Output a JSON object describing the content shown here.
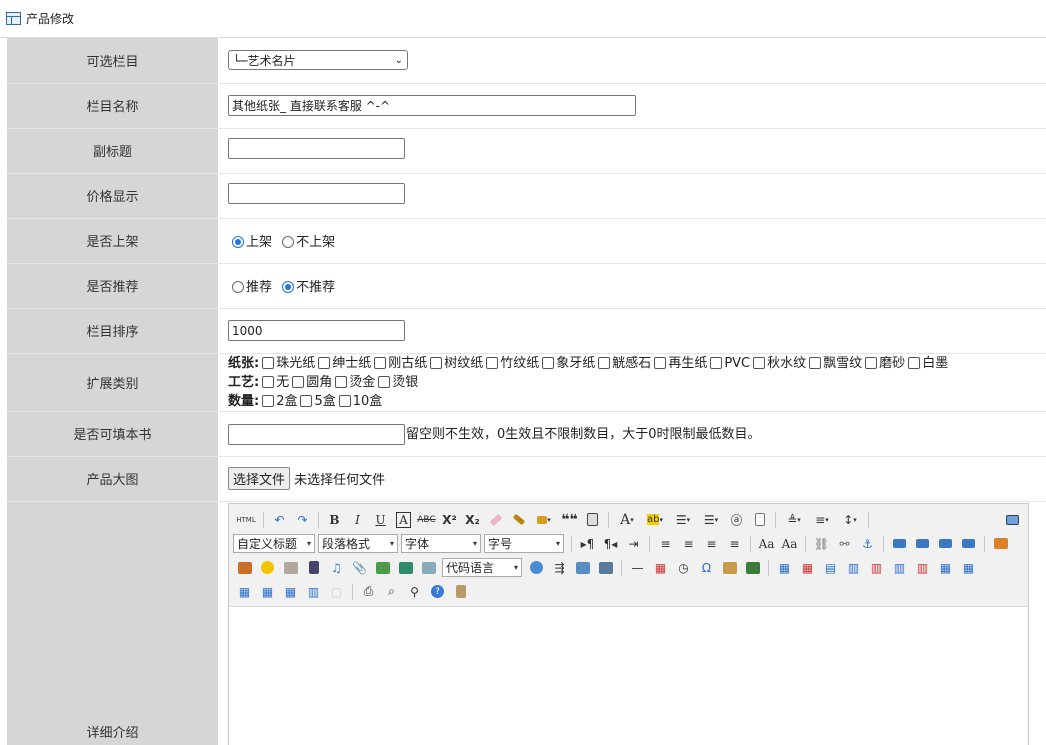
{
  "page_title": "产品修改",
  "fields": {
    "category": {
      "label": "可选栏目",
      "value": "└─艺术名片"
    },
    "name": {
      "label": "栏目名称",
      "value": "其他纸张_ 直接联系客服  ^-^"
    },
    "subtitle": {
      "label": "副标题",
      "value": ""
    },
    "price": {
      "label": "价格显示",
      "value": ""
    },
    "shelf": {
      "label": "是否上架",
      "opt1": "上架",
      "opt2": "不上架",
      "selected": "上架"
    },
    "recommend": {
      "label": "是否推荐",
      "opt1": "推荐",
      "opt2": "不推荐",
      "selected": "不推荐"
    },
    "sort": {
      "label": "栏目排序",
      "value": "1000"
    },
    "ext": {
      "label": "扩展类别",
      "paper_label": "纸张:",
      "paper": [
        "珠光纸",
        "绅士纸",
        "刚古纸",
        "树纹纸",
        "竹纹纸",
        "象牙纸",
        "觥感石",
        "再生纸",
        "PVC",
        "秋水纹",
        "飘雪纹",
        "磨砂",
        "白墨"
      ],
      "craft_label": "工艺:",
      "craft": [
        "无",
        "圆角",
        "烫金",
        "烫银"
      ],
      "qty_label": "数量:",
      "qty": [
        "2盒",
        "5盒",
        "10盒"
      ]
    },
    "book": {
      "label": "是否可填本书",
      "value": "",
      "hint": "留空则不生效，0生效且不限制数目，大于0时限制最低数目。"
    },
    "image": {
      "label": "产品大图",
      "button": "选择文件",
      "status": "未选择任何文件"
    },
    "detail": {
      "label": "详细介绍"
    }
  },
  "editor": {
    "html_label": "HTML",
    "custom_title": "自定义标题",
    "paragraph": "段落格式",
    "font": "字体",
    "size": "字号",
    "code_lang": "代码语言"
  }
}
